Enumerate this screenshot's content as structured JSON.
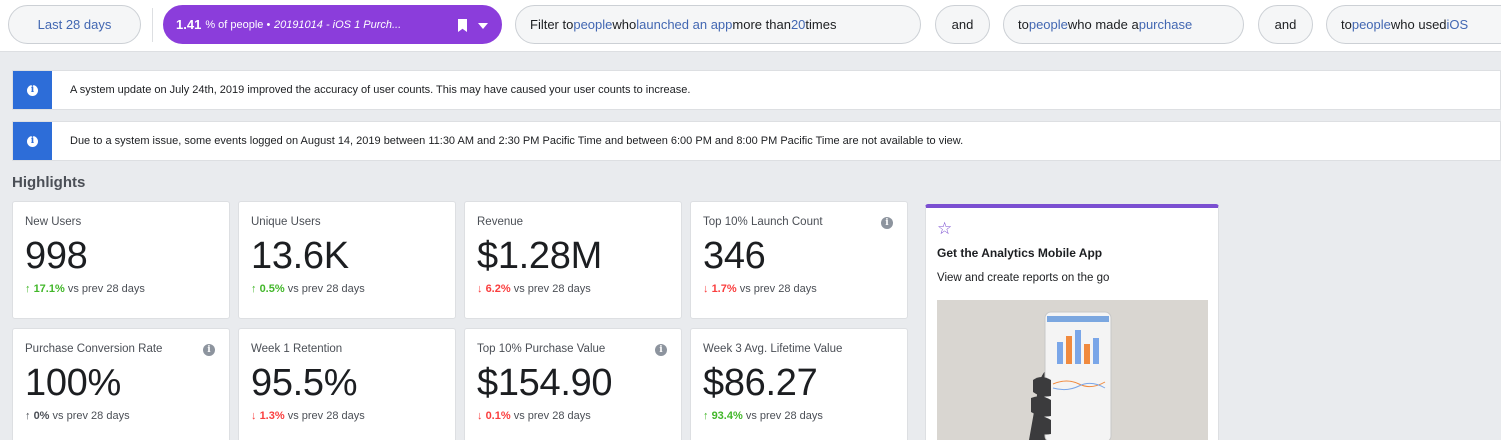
{
  "filter_bar": {
    "date_range": "Last 28 days",
    "segment": {
      "percent": "1.41",
      "suffix": "% of people •",
      "name": "20191014 - iOS 1 Purch..."
    },
    "filters": [
      {
        "p1": "Filter to ",
        "l1": "people",
        "p2": " who ",
        "l2": "launched an app",
        "p3": " more than ",
        "l3": "20",
        "p4": " times"
      },
      {
        "p1": "to ",
        "l1": "people",
        "p2": " who made a ",
        "l2": "purchase"
      },
      {
        "p1": "to ",
        "l1": "people",
        "p2": " who used ",
        "l2": "iOS"
      }
    ],
    "and_label": "and"
  },
  "notices": [
    "A system update on July 24th, 2019 improved the accuracy of user counts. This may have caused your user counts to increase.",
    "Due to a system issue, some events logged on August 14, 2019 between 11:30 AM and 2:30 PM Pacific Time and between 6:00 PM and 8:00 PM Pacific Time are not available to view."
  ],
  "highlights": {
    "title": "Highlights",
    "compare_text": "vs prev 28 days",
    "cards": [
      {
        "label": "New Users",
        "value": "998",
        "arrow": "↑",
        "delta": "17.1%",
        "trend": "up"
      },
      {
        "label": "Unique Users",
        "value": "13.6K",
        "arrow": "↑",
        "delta": "0.5%",
        "trend": "up"
      },
      {
        "label": "Revenue",
        "value": "$1.28M",
        "arrow": "↓",
        "delta": "6.2%",
        "trend": "down"
      },
      {
        "label": "Top 10% Launch Count",
        "value": "346",
        "arrow": "↓",
        "delta": "1.7%",
        "trend": "down"
      },
      {
        "label": "Purchase Conversion Rate",
        "value": "100%",
        "arrow": "↑",
        "delta": "0%",
        "trend": "neutral"
      },
      {
        "label": "Week 1 Retention",
        "value": "95.5%",
        "arrow": "↓",
        "delta": "1.3%",
        "trend": "down"
      },
      {
        "label": "Top 10% Purchase Value",
        "value": "$154.90",
        "arrow": "↓",
        "delta": "0.1%",
        "trend": "down"
      },
      {
        "label": "Week 3 Avg. Lifetime Value",
        "value": "$86.27",
        "arrow": "↑",
        "delta": "93.4%",
        "trend": "up"
      }
    ]
  },
  "promo": {
    "title": "Get the Analytics Mobile App",
    "subtitle": "View and create reports on the go"
  },
  "colors": {
    "accent": "#8b3ddb",
    "link": "#4267b2",
    "info": "#2d6dd8",
    "up": "#42b72a",
    "down": "#fa3e3e"
  }
}
